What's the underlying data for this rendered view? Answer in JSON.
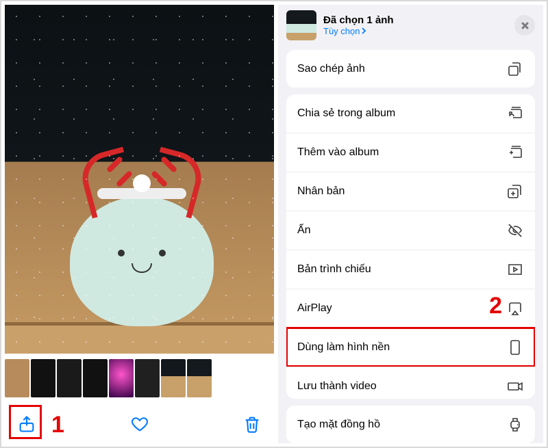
{
  "callouts": {
    "one": "1",
    "two": "2"
  },
  "left_panel": {
    "toolbar": {
      "share": "share-icon",
      "favorite": "heart-icon",
      "delete": "trash-icon"
    }
  },
  "share_sheet": {
    "title": "Đã chọn 1 ảnh",
    "options_label": "Tùy chọn",
    "close": "close-icon",
    "groups": [
      {
        "rows": [
          {
            "label": "Sao chép ảnh",
            "icon": "copy-icon"
          }
        ]
      },
      {
        "rows": [
          {
            "label": "Chia sẻ trong album",
            "icon": "shared-album-icon"
          },
          {
            "label": "Thêm vào album",
            "icon": "add-album-icon"
          },
          {
            "label": "Nhân bản",
            "icon": "duplicate-icon"
          },
          {
            "label": "Ẩn",
            "icon": "hide-icon"
          },
          {
            "label": "Bản trình chiếu",
            "icon": "slideshow-icon"
          },
          {
            "label": "AirPlay",
            "icon": "airplay-icon"
          },
          {
            "label": "Dùng làm hình nền",
            "icon": "wallpaper-icon",
            "highlight": true
          },
          {
            "label": "Lưu thành video",
            "icon": "video-icon"
          }
        ]
      },
      {
        "rows": [
          {
            "label": "Tạo mặt đồng hồ",
            "icon": "watch-icon"
          }
        ]
      }
    ]
  }
}
